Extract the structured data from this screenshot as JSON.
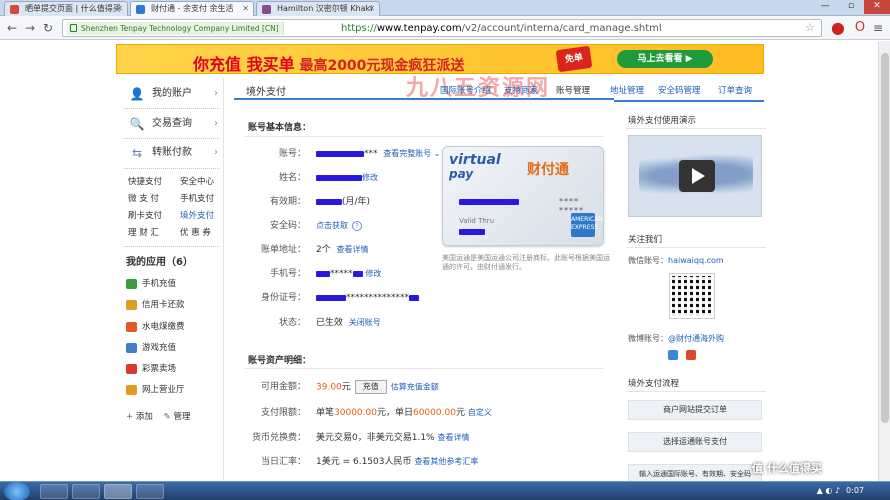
{
  "browser": {
    "tabs": [
      {
        "label": "晒单提交页面 | 什么值得买",
        "color": "#d9463d"
      },
      {
        "label": "财付通 - 余支付 余生活",
        "color": "#2b7bd5"
      },
      {
        "label": "Hamilton 汉密尔顿 Khaki",
        "color": "#8a4c8a"
      }
    ],
    "window_controls": {
      "minimize": "—",
      "restore": "▫",
      "close": "✕"
    },
    "nav": {
      "back": "←",
      "forward": "→",
      "reload": "↻"
    },
    "ev_label": "Shenzhen Tenpay Technology Company Limited [CN]",
    "url_scheme": "https://",
    "url_host": "www.tenpay.com",
    "url_path": "/v2/account/interna/card_manage.shtml"
  },
  "banner": {
    "text_a": "你充值 我买单",
    "text_b": "最高2000元现金疯狂派送",
    "stamp": "免单",
    "button": "马上去看看 ▶"
  },
  "watermark": "九八五资源网",
  "sidebar": {
    "main": [
      {
        "label": "我的账户",
        "icon": "👤"
      },
      {
        "label": "交易查询",
        "icon": "🔍"
      },
      {
        "label": "转账付款",
        "icon": "⇆"
      }
    ],
    "links": [
      {
        "label": "快捷支付",
        "active": false
      },
      {
        "label": "安全中心",
        "active": false
      },
      {
        "label": "微 支 付",
        "active": false
      },
      {
        "label": "手机支付",
        "active": false
      },
      {
        "label": "刷卡支付",
        "active": false
      },
      {
        "label": "境外支付",
        "active": true
      },
      {
        "label": "理 财 汇",
        "active": false
      },
      {
        "label": "优 惠 券",
        "active": false
      }
    ],
    "apps_title": "我的应用（6）",
    "apps": [
      {
        "label": "手机充值",
        "color": "#3c9b3c"
      },
      {
        "label": "信用卡还款",
        "color": "#e19b23"
      },
      {
        "label": "水电煤缴费",
        "color": "#e2572a"
      },
      {
        "label": "游戏充值",
        "color": "#3f7fc8"
      },
      {
        "label": "彩票卖场",
        "color": "#d73b2f"
      },
      {
        "label": "网上营业厅",
        "color": "#e39a1c"
      }
    ],
    "add_label": "添加",
    "manage_label": "管理"
  },
  "content": {
    "title": "境外支付",
    "tabs": [
      {
        "label": "国际账号介绍",
        "active": false
      },
      {
        "label": "支持商家",
        "active": false
      },
      {
        "label": "账号管理",
        "active": true
      },
      {
        "label": "地址管理",
        "active": false
      },
      {
        "label": "安全码管理",
        "active": false
      },
      {
        "label": "订单查询",
        "active": false
      }
    ],
    "basic_title": "账号基本信息：",
    "account": {
      "account_label": "账号：",
      "account_suffix": "***",
      "account_link": "查看完整账号",
      "name_label": "姓名：",
      "name_link": "修改",
      "expiry_label": "有效期：",
      "expiry_suffix": "(月/年)",
      "security_label": "安全码：",
      "security_link": "点击获取",
      "address_label": "账单地址：",
      "address_count": "2个",
      "address_link": "查看详情",
      "phone_label": "手机号：",
      "phone_mid": "*****",
      "phone_link": "修改",
      "id_label": "身份证号：",
      "id_mid": "**************",
      "status_label": "状态：",
      "status_value": "已生效",
      "status_link": "关闭账号"
    },
    "card": {
      "virtual": "virtual",
      "pay": "pay",
      "brand": "财付通",
      "stars": "**** *****",
      "valid": "Valid  Thru",
      "amex": "AMERICAN EXPRESS",
      "note": "美国运通是美国运通公司注册商标。此账号根据美国运通的许可，由财付通发行。"
    },
    "asset_title": "账号资产明细：",
    "assets": {
      "balance_label": "可用金额：",
      "balance_value": "39.00",
      "balance_unit": "元",
      "recharge_btn": "充值",
      "balance_link": "估算充值金额",
      "limit_label": "支付限额：",
      "limit_single_pre": "单笔",
      "limit_single": "30000.00",
      "limit_single_unit": "元，单日",
      "limit_daily": "60000.00",
      "limit_daily_unit": "元",
      "limit_link": "自定义",
      "fx_label": "货币兑换费：",
      "fx_value": "美元交易0，非美元交易1.1%",
      "fx_link": "查看详情",
      "rate_label": "当日汇率：",
      "rate_value": "1美元 = 6.1503人民币",
      "rate_link": "查看其他参考汇率"
    }
  },
  "right": {
    "demo_title": "境外支付使用演示",
    "follow_title": "关注我们",
    "wechat_label": "微信账号：",
    "wechat_value": "haiwaiqq.com",
    "weibo_label": "微博账号：",
    "weibo_value": "@财付通海外购",
    "flow_title": "境外支付流程",
    "flow_steps": [
      "商户网站提交订单",
      "选择运通账号支付",
      "输入运通国际账号、有效期、安全码"
    ]
  },
  "site_watermark": "值 什么值得买",
  "taskbar": {
    "clock": "0:07"
  },
  "colors": {
    "accent": "#1e5fb3",
    "orange": "#e9600f",
    "mask": "#2a18e0"
  }
}
